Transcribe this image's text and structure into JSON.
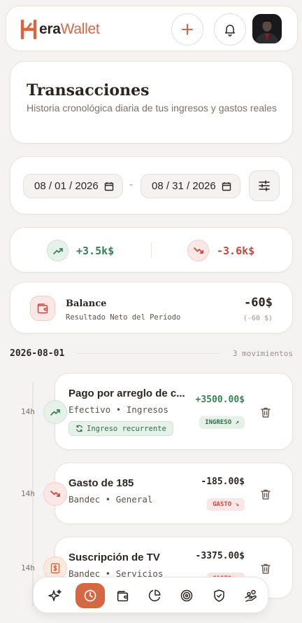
{
  "header": {
    "logo_prefix": "era",
    "logo_suffix": "Wallet",
    "add_icon": "plus-icon",
    "notif_icon": "bell-icon"
  },
  "title": {
    "text": "Transacciones",
    "subtitle": "Historia cronológica diaria de tus ingresos y gastos reales"
  },
  "filter": {
    "from_date": "08 / 01 / 2026",
    "to_date": "08 / 31 / 2026",
    "separator": "-"
  },
  "summary": {
    "income": "+3.5k$",
    "expense": "-3.6k$"
  },
  "balance": {
    "title": "Balance",
    "subtitle": "Resultado Neto del Período",
    "value": "-60$",
    "value_detail": "(-60 $)"
  },
  "group": {
    "date": "2026-08-01",
    "count": "3 movimientos"
  },
  "transactions": [
    {
      "time": "14h",
      "name": "Pago por arreglo de c...",
      "meta": "Efectivo • Ingresos",
      "amount": "+3500.00$",
      "badge": "INGRESO ↗",
      "recurring": "Ingreso recurrente"
    },
    {
      "time": "14h",
      "name": "Gasto de 185",
      "meta": "Bandec • General",
      "amount": "-185.00$",
      "badge": "GASTO ↘"
    },
    {
      "time": "14h",
      "name": "Suscripción de TV",
      "meta": "Bandec • Servicios",
      "amount": "-3375.00$",
      "badge": "GASTO ↘"
    }
  ],
  "colors": {
    "accent": "#d66743",
    "income": "#3c7e55",
    "expense": "#c2493f",
    "background": "#f5f3f1"
  },
  "nav": {
    "items": [
      "sparkles-icon",
      "clock-icon",
      "wallet-icon",
      "pie-chart-icon",
      "target-icon",
      "shield-icon",
      "hand-coins-icon"
    ],
    "active": "clock-icon"
  }
}
